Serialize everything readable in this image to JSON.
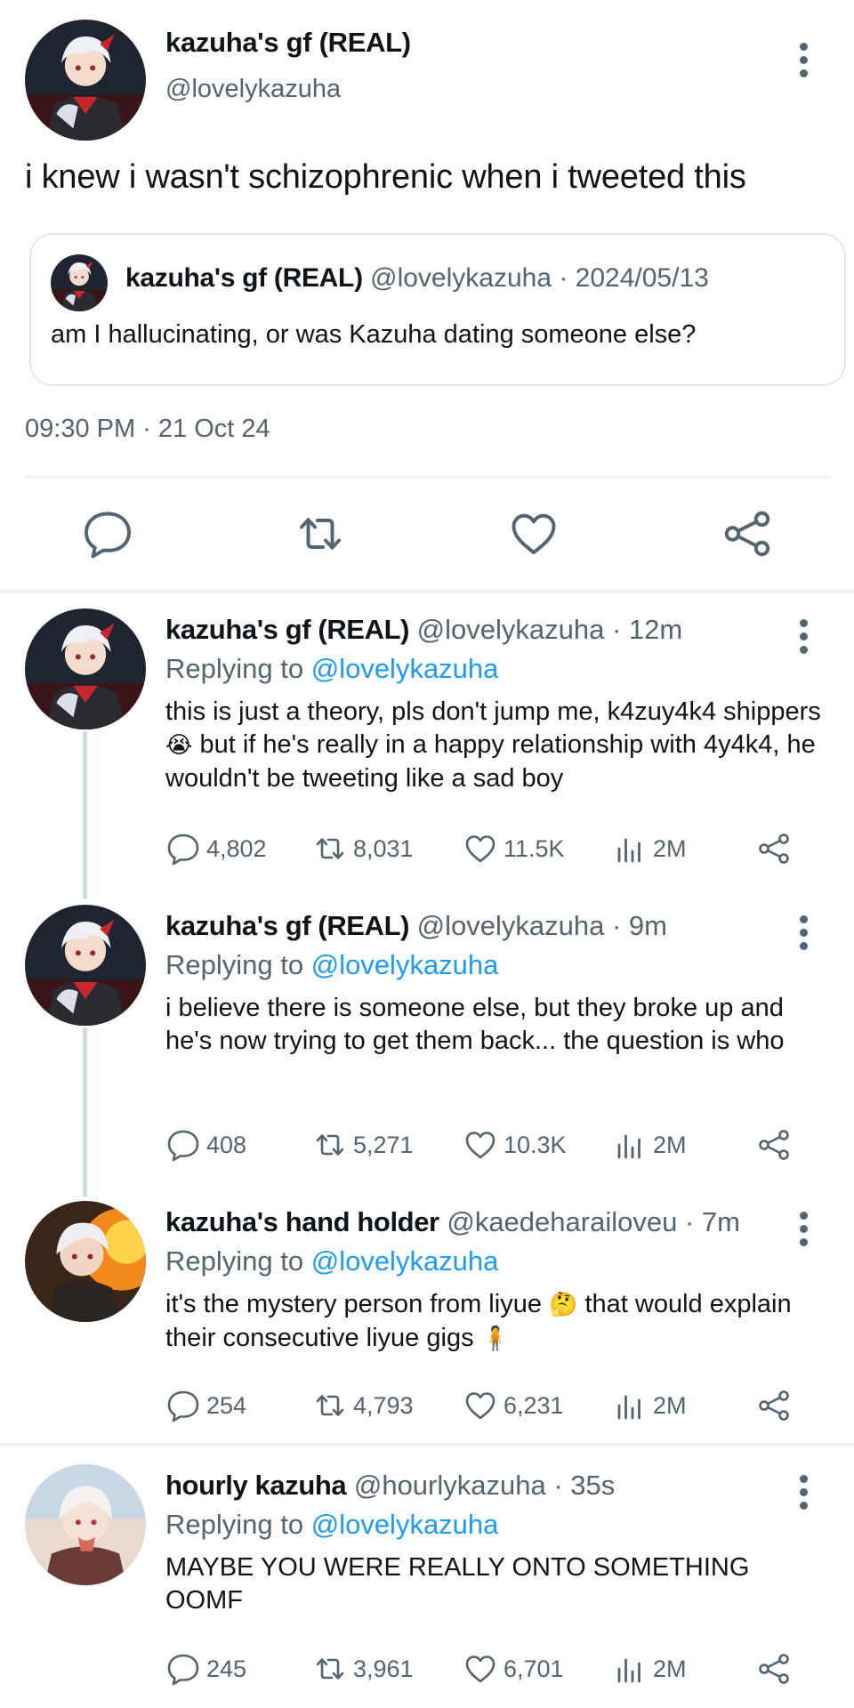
{
  "tweet": {
    "author_name": "kazuha's gf (REAL)",
    "author_handle": "@lovelykazuha",
    "text": "i knew i wasn't schizophrenic when i tweeted this",
    "timestamp": "09:30 PM · 21 Oct 24",
    "quoted": {
      "author_name": "kazuha's gf (REAL)",
      "meta": "@lovelykazuha · 2024/05/13",
      "text": "am I hallucinating, or was Kazuha dating someone else?"
    },
    "actions": [
      {
        "name": "reply-icon"
      },
      {
        "name": "retweet-icon"
      },
      {
        "name": "like-icon"
      },
      {
        "name": "share-icon"
      }
    ]
  },
  "replies": [
    {
      "author_name": "kazuha's gf (REAL)",
      "meta": "@lovelykazuha · 12m",
      "replying_prefix": "Replying to ",
      "replying_to": "@lovelykazuha",
      "text_1": "this is just a theory, pls don't jump me, k4zuy4k4 shippers",
      "emoji_1": "😭",
      "text_2": "but if he's really in a happy relationship with 4y4k4, he wouldn't be tweeting like a sad boy",
      "stats": {
        "replies": "4,802",
        "retweets": "8,031",
        "likes": "11.5K",
        "views": "2M"
      }
    },
    {
      "author_name": "kazuha's gf (REAL)",
      "meta": "@lovelykazuha · 9m",
      "replying_prefix": "Replying to ",
      "replying_to": "@lovelykazuha",
      "text_1": "i believe there is someone else, but they broke up and he's now trying to get them back... the question is who",
      "stats": {
        "replies": "408",
        "retweets": "5,271",
        "likes": "10.3K",
        "views": "2M"
      }
    },
    {
      "author_name": "kazuha's hand holder",
      "meta": "@kaedeharailoveu · 7m",
      "replying_prefix": "Replying to ",
      "replying_to": "@lovelykazuha",
      "text_1": "it's the mystery person from liyue",
      "emoji_1": "🤔",
      "text_2": "that would explain their consecutive liyue gigs",
      "emoji_2": "🧍",
      "stats": {
        "replies": "254",
        "retweets": "4,793",
        "likes": "6,231",
        "views": "2M"
      }
    },
    {
      "author_name": "hourly kazuha",
      "meta": "@hourlykazuha · 35s",
      "replying_prefix": "Replying to ",
      "replying_to": "@lovelykazuha",
      "text_1": "MAYBE YOU WERE REALLY ONTO SOMETHING OOMF",
      "stats": {
        "replies": "245",
        "retweets": "3,961",
        "likes": "6,701",
        "views": "2M"
      }
    }
  ],
  "colors": {
    "link": "#1d9bf0",
    "muted": "#536471",
    "text": "#0f1419",
    "divider": "#e6ecf0"
  }
}
